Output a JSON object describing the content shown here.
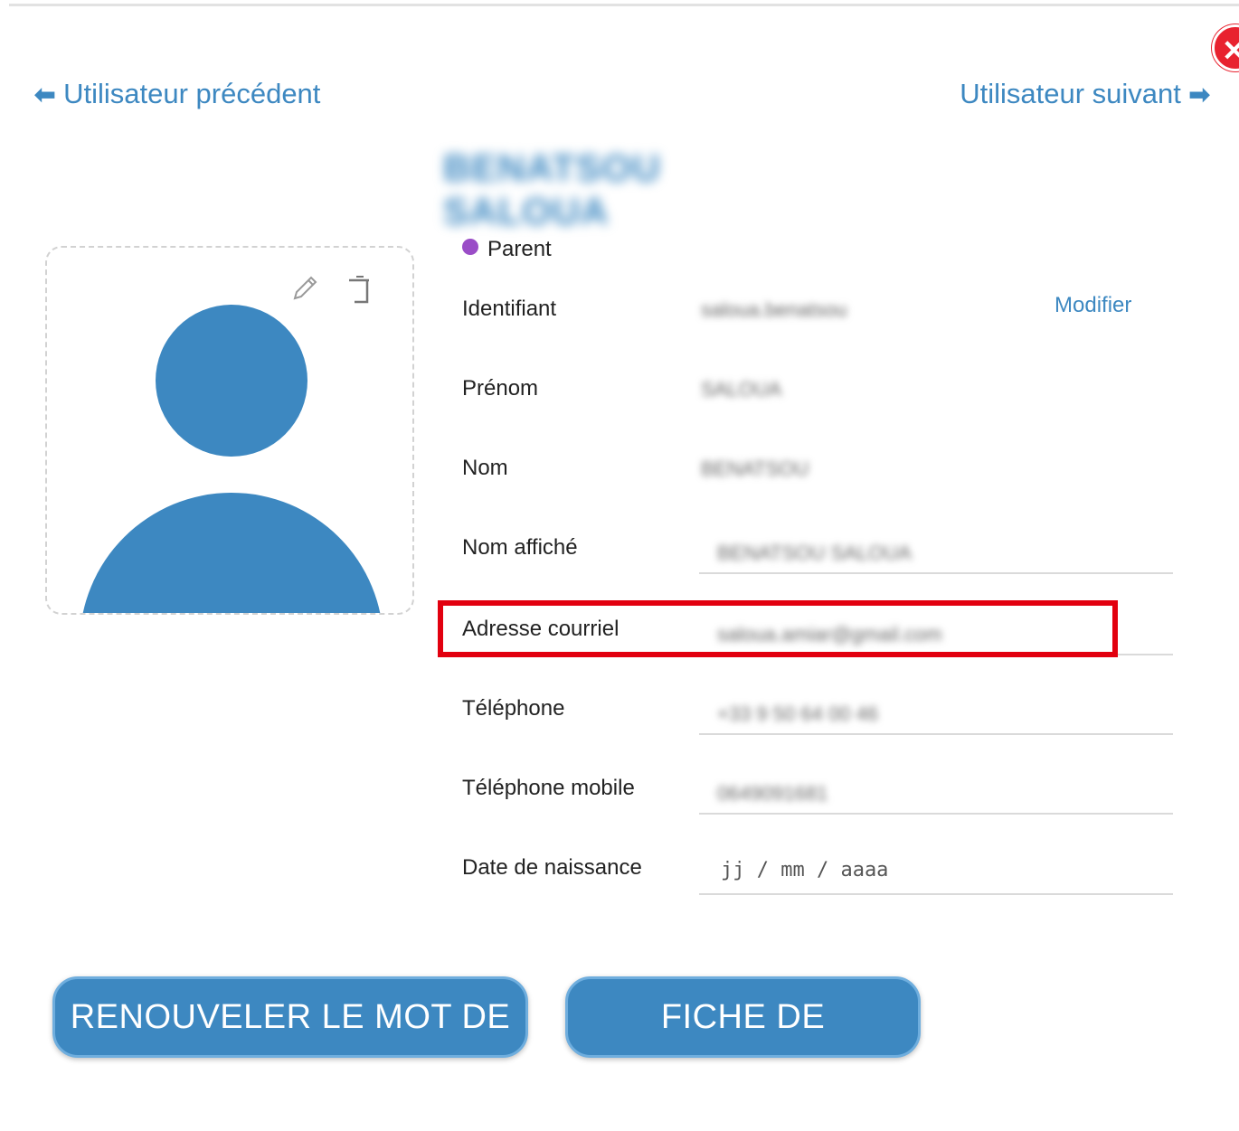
{
  "nav": {
    "previous_label": "Utilisateur précédent",
    "next_label": "Utilisateur suivant",
    "previous_arrow": "🡄",
    "next_arrow": "🡆"
  },
  "close_icon": "✕",
  "page_title": "BENATSOU SALOUA",
  "role": {
    "label": "Parent",
    "color": "#9a4dc7"
  },
  "fields": {
    "identifiant": {
      "label": "Identifiant",
      "value": "saloua.benatsou",
      "action": "Modifier"
    },
    "prenom": {
      "label": "Prénom",
      "value": "SALOUA"
    },
    "nom": {
      "label": "Nom",
      "value": "BENATSOU"
    },
    "nom_affiche": {
      "label": "Nom affiché",
      "value": "BENATSOU SALOUA"
    },
    "email": {
      "label": "Adresse courriel",
      "value": "saloua.amiar@gmail.com"
    },
    "telephone": {
      "label": "Téléphone",
      "value": "+33 9 50 64 00 46"
    },
    "mobile": {
      "label": "Téléphone mobile",
      "value": "0649091681"
    },
    "naissance": {
      "label": "Date de naissance",
      "placeholder": "jj / mm / aaaa"
    }
  },
  "buttons": {
    "renew_password": "RENOUVELER LE MOT DE PASSE",
    "login_sheet": "FICHE DE CONNEXION"
  },
  "colors": {
    "accent": "#3d88c1",
    "highlight": "#e2000f",
    "close": "#e8222f"
  }
}
